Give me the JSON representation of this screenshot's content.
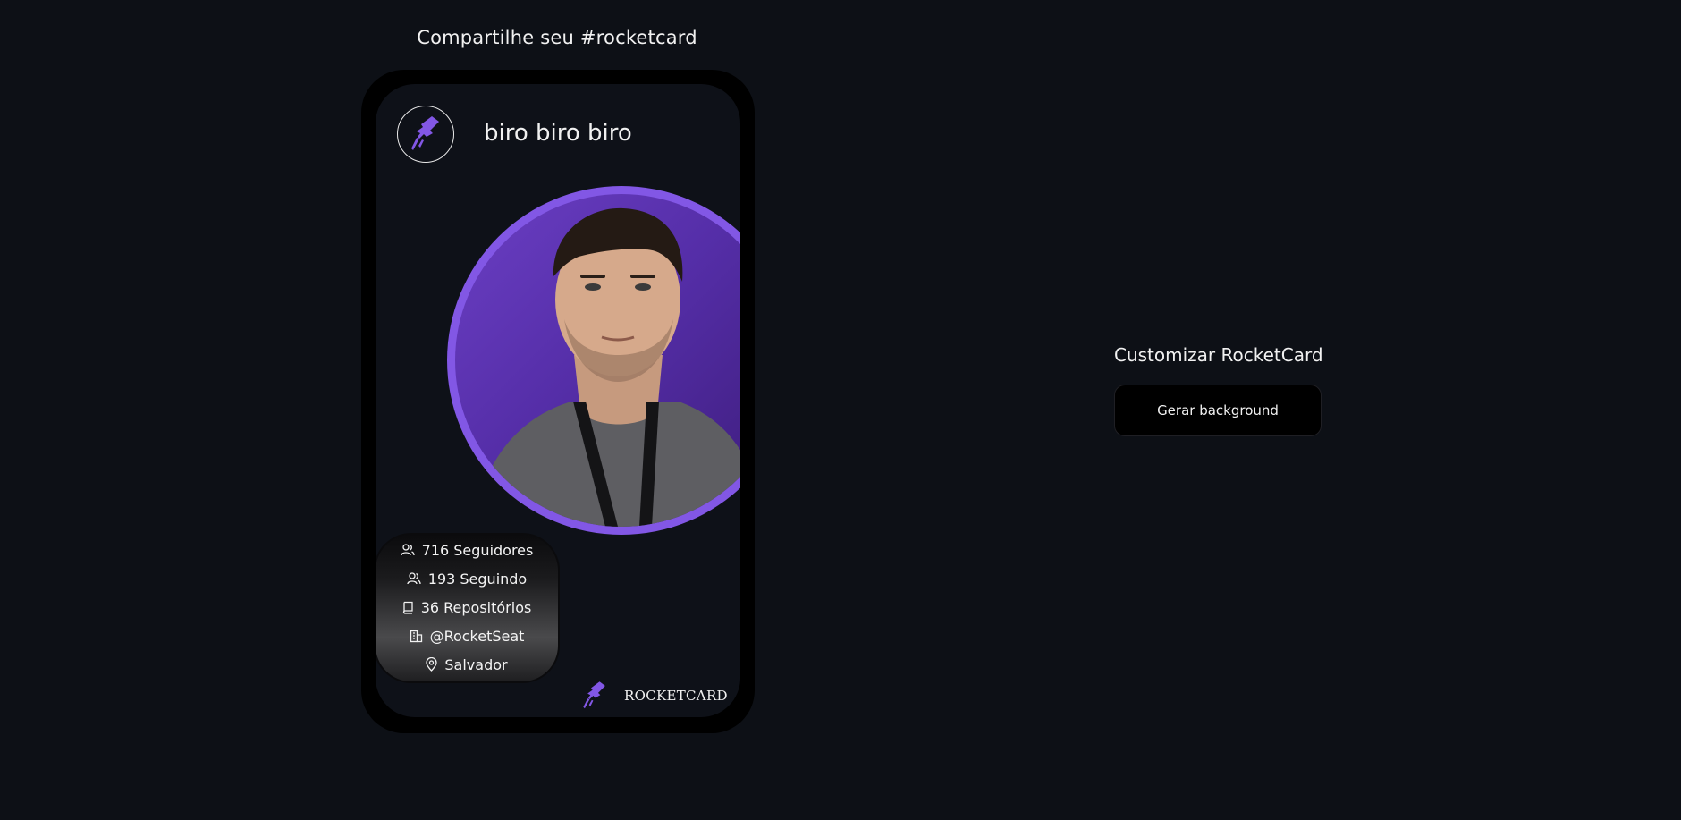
{
  "share": {
    "title": "Compartilhe seu #rocketcard"
  },
  "card": {
    "user_name": "biro biro biro",
    "stats": {
      "followers": "716 Seguidores",
      "following": "193 Seguindo",
      "repositories": "36 Repositórios",
      "company": "@RocketSeat",
      "location": "Salvador"
    },
    "brand_text": "ROCKETCARD"
  },
  "customize": {
    "title": "Customizar RocketCard",
    "button_label": "Gerar background"
  },
  "colors": {
    "background": "#0d1016",
    "card_screen": "#0e1118",
    "phone_frame": "#000000",
    "accent_purple": "#8257e5",
    "text": "#f1f1f1"
  },
  "icons": {
    "logo": "rocketseat-logo-icon",
    "followers": "users-icon",
    "following": "users-icon",
    "repositories": "book-icon",
    "company": "building-icon",
    "location": "map-pin-icon"
  }
}
